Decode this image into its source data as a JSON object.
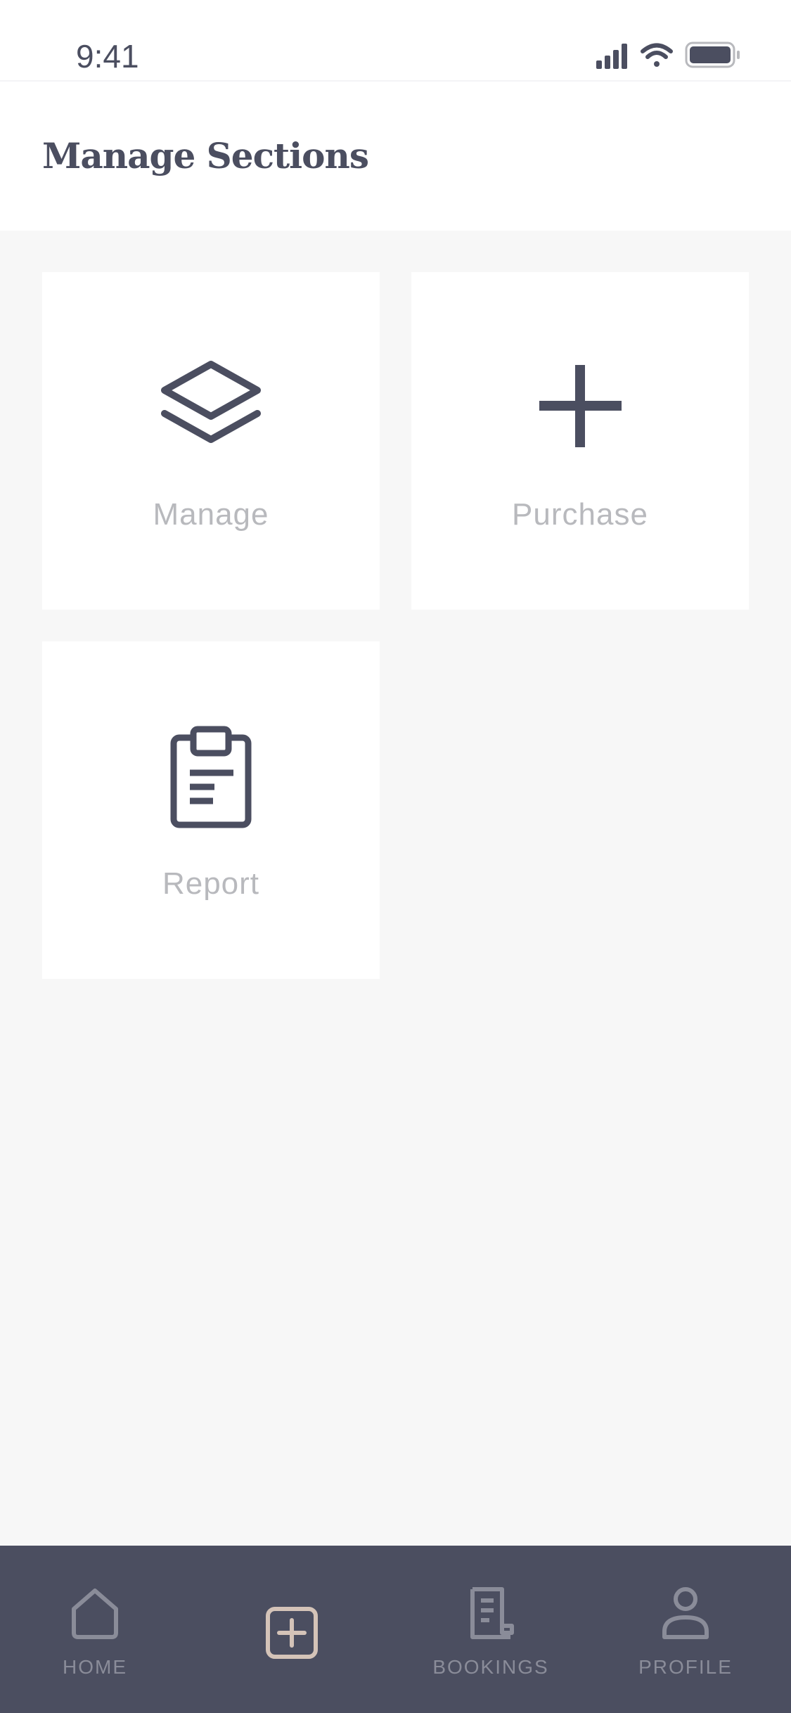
{
  "status_bar": {
    "time": "9:41",
    "icons": [
      "signal-icon",
      "wifi-icon",
      "battery-icon"
    ]
  },
  "header": {
    "title": "Manage Sections"
  },
  "sections": [
    {
      "label": "Manage",
      "icon": "layers-icon"
    },
    {
      "label": "Purchase",
      "icon": "plus-icon"
    },
    {
      "label": "Report",
      "icon": "clipboard-icon"
    }
  ],
  "tab_bar": {
    "tabs": [
      {
        "label": "HOME",
        "icon": "home-icon"
      },
      {
        "label": "",
        "icon": "add-square-icon"
      },
      {
        "label": "BOOKINGS",
        "icon": "receipt-icon"
      },
      {
        "label": "PROFILE",
        "icon": "user-icon"
      }
    ]
  },
  "colors": {
    "primary": "#4b4e60",
    "label_gray": "#b8b9bd",
    "background": "#f7f7f7",
    "tab_inactive": "#8a8c99",
    "tab_active_accent": "#d4c3b8"
  }
}
